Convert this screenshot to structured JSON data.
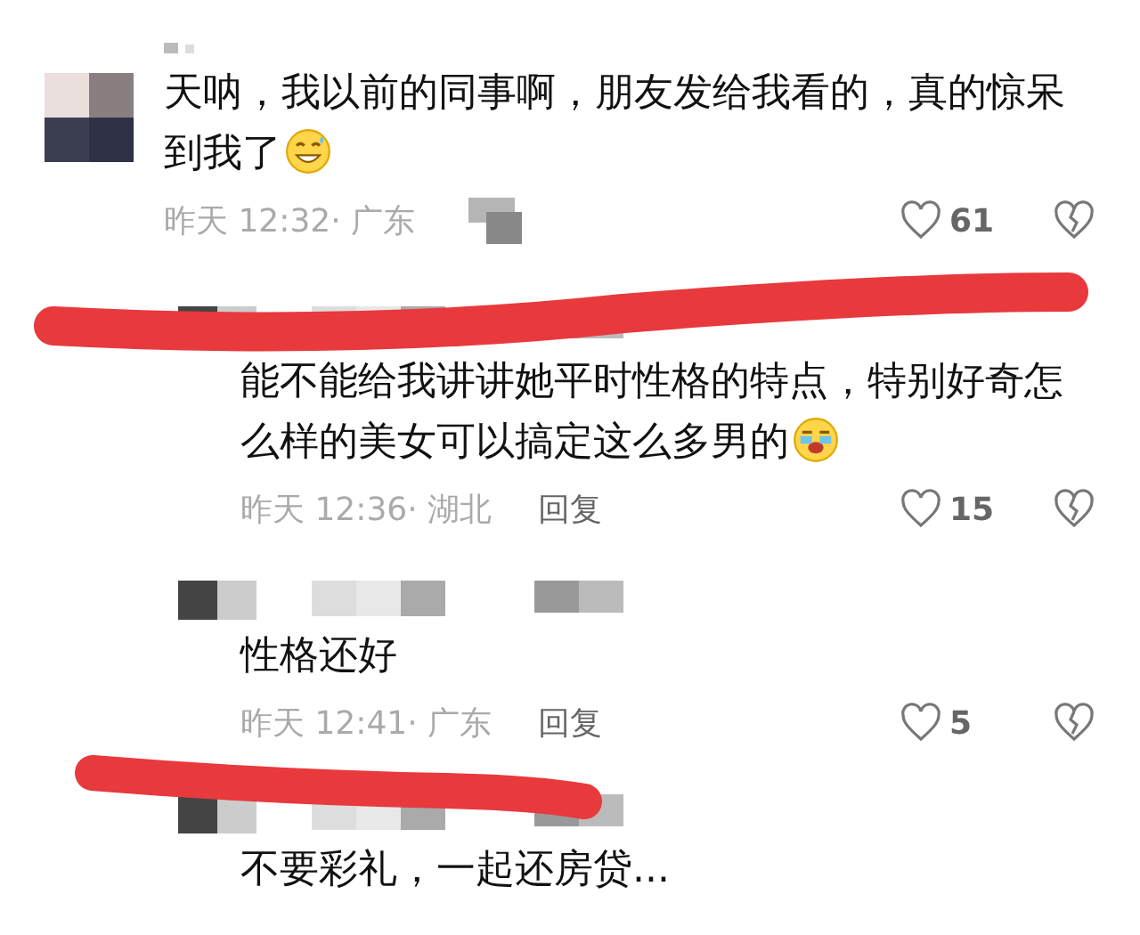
{
  "comments": [
    {
      "kind": "top",
      "text": "天呐，我以前的同事啊，朋友发给我看的，真的惊呆到我了",
      "emoji": {
        "kind": "grin"
      },
      "time_location": "昨天 12:32· 广东",
      "likes": "61"
    },
    {
      "kind": "reply",
      "text": "能不能给我讲讲她平时性格的特点，特别好奇怎么样的美女可以搞定这么多男的",
      "emoji": {
        "kind": "cry"
      },
      "time_location": "昨天 12:36· 湖北",
      "reply": "回复",
      "likes": "15"
    },
    {
      "kind": "reply",
      "text": "性格还好",
      "time_location": "昨天 12:41· 广东",
      "reply": "回复",
      "likes": "5"
    },
    {
      "kind": "reply",
      "text": "不要彩礼，一起还房贷..."
    }
  ]
}
